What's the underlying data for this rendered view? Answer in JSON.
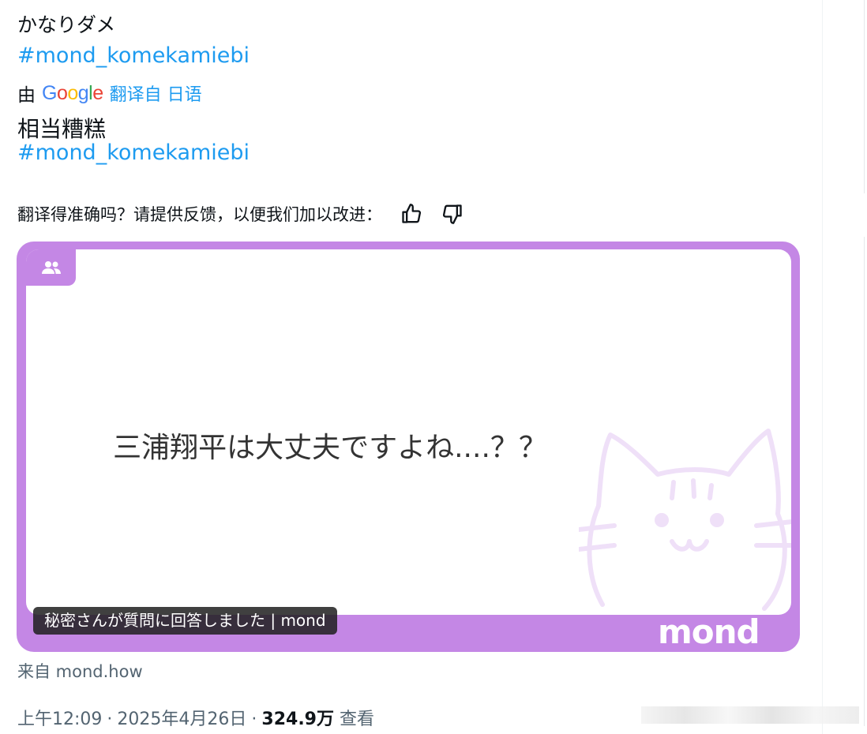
{
  "tweet": {
    "original_text": "かなりダメ",
    "hashtag": "#mond_komekamiebi",
    "translation": {
      "by_label": "由",
      "provider": "Google",
      "from_label": "翻译自 日语",
      "text": "相当糟糕",
      "hashtag": "#mond_komekamiebi"
    },
    "feedback": {
      "prompt": "翻译得准确吗？请提供反馈，以便我们加以改进：",
      "thumbs_up_icon": "thumbs-up-icon",
      "thumbs_down_icon": "thumbs-down-icon"
    },
    "card": {
      "question": "三浦翔平は大丈夫ですよね....？？",
      "caption": "秘密さんが質問に回答しました | mond",
      "brand": "mond",
      "colors": {
        "frame": "#c487e5",
        "cat": "#f1e3fa"
      }
    },
    "source": "来自 mond.how",
    "meta": {
      "time": "上午12:09",
      "date": "2025年4月26日",
      "views_count": "324.9万",
      "views_label": "查看"
    }
  },
  "colors": {
    "link": "#1d9bf0",
    "text": "#0f1419",
    "secondary": "#536471"
  }
}
